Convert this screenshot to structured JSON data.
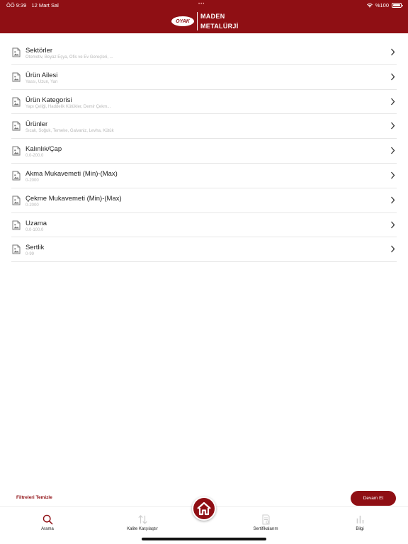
{
  "status_bar": {
    "time": "ÖÖ 9:39",
    "date": "12 Mart Sal",
    "dots": "•••",
    "battery": "%100"
  },
  "brand": {
    "oval_text": "OYAK",
    "line1": "MADEN",
    "line2": "METALÜRJİ"
  },
  "filters": [
    {
      "title": "Sektörler",
      "subtitle": "Otomotiv, Beyaz Eşya, Ofis ve Ev Gereçleri, ..."
    },
    {
      "title": "Ürün Ailesi",
      "subtitle": "Yassı, Uzun, Yarı"
    },
    {
      "title": "Ürün Kategorisi",
      "subtitle": "Yapı Çeliği, Haddelik Kütükler, Demir Çekm..."
    },
    {
      "title": "Ürünler",
      "subtitle": "Sıcak, Soğuk, Temeke, Galvaniz, Levha, Kütük"
    },
    {
      "title": "Kalınlık/Çap",
      "subtitle": "0.0-200.0"
    },
    {
      "title": "Akma Mukavemeti (Min)-(Max)",
      "subtitle": "0-2000"
    },
    {
      "title": "Çekme Mukavemeti (Min)-(Max)",
      "subtitle": "0-2000"
    },
    {
      "title": "Uzama",
      "subtitle": "0.0-100.0"
    },
    {
      "title": "Sertlik",
      "subtitle": "0-99"
    }
  ],
  "actions": {
    "clear_label": "Filtreleri Temizle",
    "continue_label": "Devam Et"
  },
  "tabs": [
    {
      "label": "Arama",
      "icon": "search-icon",
      "active": true
    },
    {
      "label": "Kalite Karşılaştır",
      "icon": "swap-arrows-icon",
      "active": false
    },
    {
      "label": "Sertifikalarım",
      "icon": "certificate-icon",
      "active": false
    },
    {
      "label": "Bilgi",
      "icon": "bar-chart-icon",
      "active": false
    }
  ],
  "colors": {
    "brand": "#8f0f14",
    "divider": "#e6e6e6",
    "subtitle": "#b8b8b8",
    "inactive": "#cfcfcf"
  }
}
